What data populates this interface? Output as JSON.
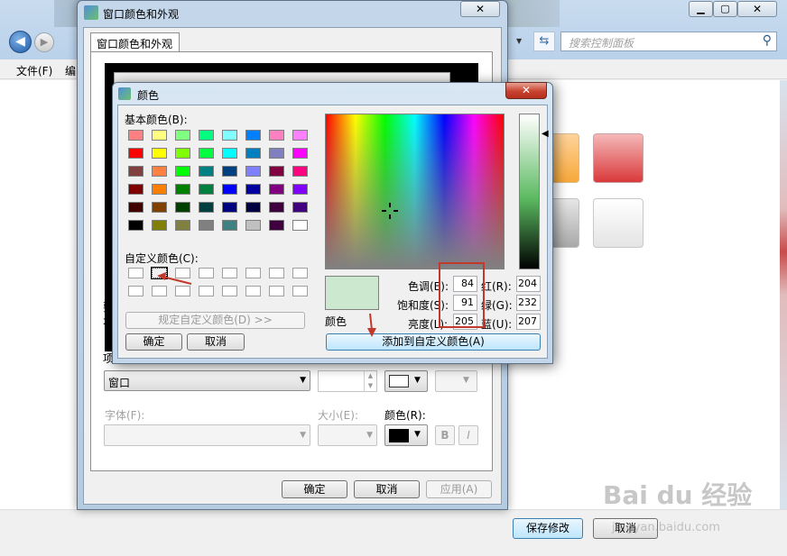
{
  "control_panel": {
    "search_placeholder": "搜索控制面板",
    "menu_file": "文件(F)",
    "menu_edit": "编",
    "save_button": "保存修改",
    "cancel_button": "取消"
  },
  "appearance_dialog": {
    "title": "窗口颜色和外观",
    "tab": "窗口颜色和外观",
    "left_fragment_1": "要",
    "left_fragment_2": "本",
    "left_fragment_3": "项",
    "item_value": "窗口",
    "font_label": "字体(F):",
    "size_label": "大小(E):",
    "color_label": "颜色(R):",
    "bold_label": "B",
    "italic_label": "I",
    "ok": "确定",
    "cancel": "取消",
    "apply": "应用(A)"
  },
  "color_dialog": {
    "title": "颜色",
    "basic_colors_label": "基本颜色(B):",
    "custom_colors_label": "自定义颜色(C):",
    "define_custom_button": "规定自定义颜色(D) >>",
    "ok": "确定",
    "cancel": "取消",
    "color_solid_label": "颜色",
    "add_to_custom_button": "添加到自定义颜色(A)",
    "hue_label": "色调(E):",
    "sat_label": "饱和度(S):",
    "lum_label": "亮度(L):",
    "red_label": "红(R):",
    "green_label": "绿(G):",
    "blue_label": "蓝(U):",
    "hue": "84",
    "sat": "91",
    "lum": "205",
    "red": "204",
    "green": "232",
    "blue": "207",
    "current_color": "#cce8cf",
    "basic_colors": [
      "#ff8080",
      "#ffff80",
      "#80ff80",
      "#00ff80",
      "#80ffff",
      "#0080ff",
      "#ff80c0",
      "#ff80ff",
      "#ff0000",
      "#ffff00",
      "#80ff00",
      "#00ff40",
      "#00ffff",
      "#0080c0",
      "#8080c0",
      "#ff00ff",
      "#804040",
      "#ff8040",
      "#00ff00",
      "#008080",
      "#004080",
      "#8080ff",
      "#800040",
      "#ff0080",
      "#800000",
      "#ff8000",
      "#008000",
      "#008040",
      "#0000ff",
      "#0000a0",
      "#800080",
      "#8000ff",
      "#400000",
      "#804000",
      "#004000",
      "#004040",
      "#000080",
      "#000040",
      "#400040",
      "#400080",
      "#000000",
      "#808000",
      "#808040",
      "#808080",
      "#408080",
      "#c0c0c0",
      "#400040",
      "#ffffff"
    ]
  },
  "watermark": {
    "brand": "Bai du 经验",
    "url": "jingyan.baidu.com"
  }
}
